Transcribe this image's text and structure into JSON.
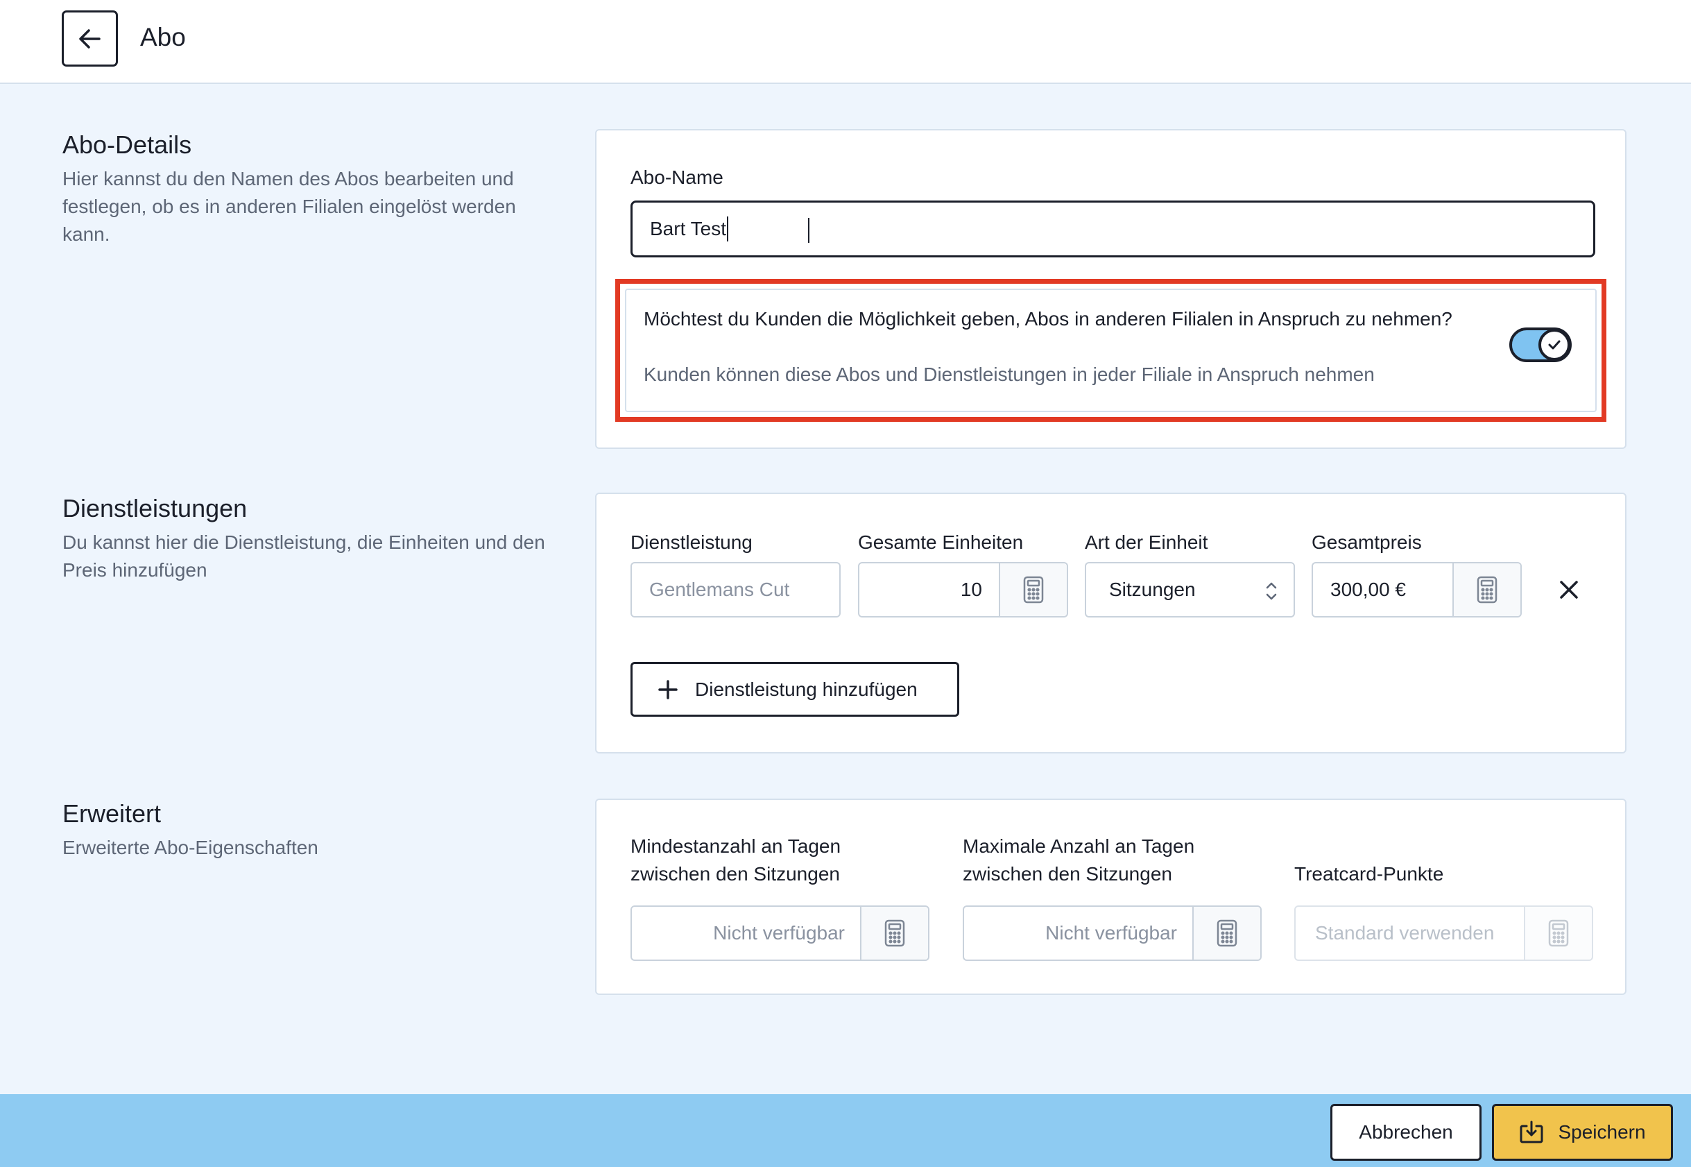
{
  "header": {
    "title": "Abo",
    "back_icon": "arrow-left-icon"
  },
  "details": {
    "title": "Abo-Details",
    "description": "Hier kannst du den Namen des Abos bearbeiten und festlegen, ob es in anderen Filialen eingelöst werden kann.",
    "name_label": "Abo-Name",
    "name_value": "Bart Test",
    "cross_branch_question": "Möchtest du Kunden die Möglichkeit geben, Abos in anderen Filialen in Anspruch zu nehmen?",
    "cross_branch_hint": "Kunden können diese Abos und Dienstleistungen in jeder Filiale in Anspruch nehmen",
    "cross_branch_enabled": true,
    "highlight_color": "#e23a24"
  },
  "services": {
    "title": "Dienstleistungen",
    "description": "Du kannst hier die Dienstleistung, die Einheiten und den Preis hinzufügen",
    "labels": {
      "service": "Dienstleistung",
      "units": "Gesamte Einheiten",
      "unit_type": "Art der Einheit",
      "price": "Gesamtpreis"
    },
    "row": {
      "service_placeholder": "Gentlemans Cut",
      "units": "10",
      "unit_type": "Sitzungen",
      "price": "300,00 €"
    },
    "add_button": "Dienstleistung hinzufügen"
  },
  "advanced": {
    "title": "Erweitert",
    "description": "Erweiterte Abo-Eigenschaften",
    "min_label_line1": "Mindestanzahl an Tagen",
    "min_label_line2": "zwischen den Sitzungen",
    "min_placeholder": "Nicht verfügbar",
    "max_label_line1": "Maximale Anzahl an Tagen",
    "max_label_line2": "zwischen den Sitzungen",
    "max_placeholder": "Nicht verfügbar",
    "points_label": "Treatcard-Punkte",
    "points_placeholder": "Standard verwenden"
  },
  "footer": {
    "cancel": "Abbrechen",
    "save": "Speichern"
  },
  "colors": {
    "footer_bg": "#8ecbf2",
    "save_bg": "#f1c34c",
    "toggle_on": "#7fc3f1"
  }
}
